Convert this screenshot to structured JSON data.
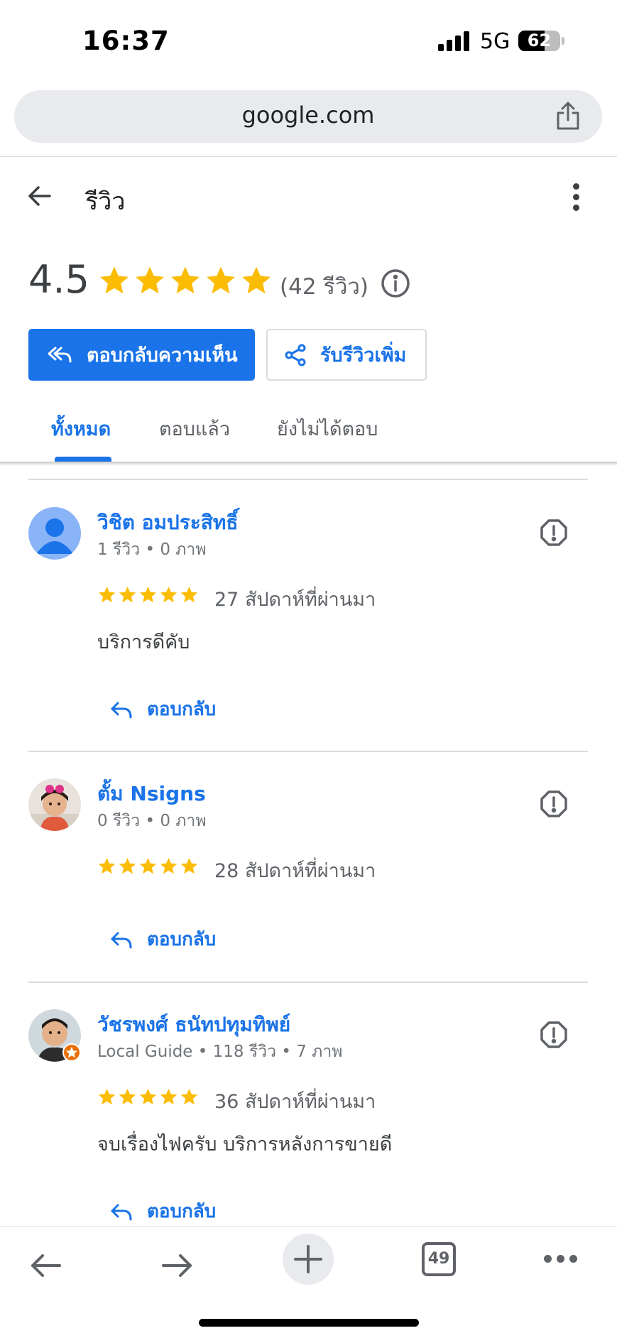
{
  "status_bar": {
    "time": "16:37",
    "network": "5G",
    "battery": "62"
  },
  "browser": {
    "url": "google.com"
  },
  "header": {
    "title": "รีวิว"
  },
  "summary": {
    "rating": "4.5",
    "stars": 5,
    "count_text": "(42 รีวิว)"
  },
  "buttons": {
    "reply_reviews": "ตอบกลับความเห็น",
    "get_more_reviews": "รับรีวิวเพิ่ม"
  },
  "tabs": [
    {
      "label": "ทั้งหมด",
      "active": true
    },
    {
      "label": "ตอบแล้ว",
      "active": false
    },
    {
      "label": "ยังไม่ได้ตอบ",
      "active": false
    }
  ],
  "reviews": [
    {
      "name": "วิชิต อมประสิทธิ์",
      "meta": "1 รีวิว • 0 ภาพ",
      "rating": 5,
      "time": "27 สัปดาห์ที่ผ่านมา",
      "text": "บริการดีคับ",
      "reply_label": "ตอบกลับ"
    },
    {
      "name": "ตั้ม Nsigns",
      "meta": "0 รีวิว • 0 ภาพ",
      "rating": 5,
      "time": "28 สัปดาห์ที่ผ่านมา",
      "text": "",
      "reply_label": "ตอบกลับ"
    },
    {
      "name": "วัชรพงศ์ ธนัทปทุมทิพย์",
      "meta": "Local Guide • 118 รีวิว • 7 ภาพ",
      "rating": 5,
      "time": "36 สัปดาห์ที่ผ่านมา",
      "text": "จบเรื่องไฟครับ บริการหลังการขายดี",
      "reply_label": "ตอบกลับ"
    }
  ],
  "toolbar": {
    "tab_count": "49"
  },
  "colors": {
    "accent": "#1a73e8",
    "star": "#fbbc04",
    "text": "#3c4043",
    "muted": "#70757a"
  }
}
